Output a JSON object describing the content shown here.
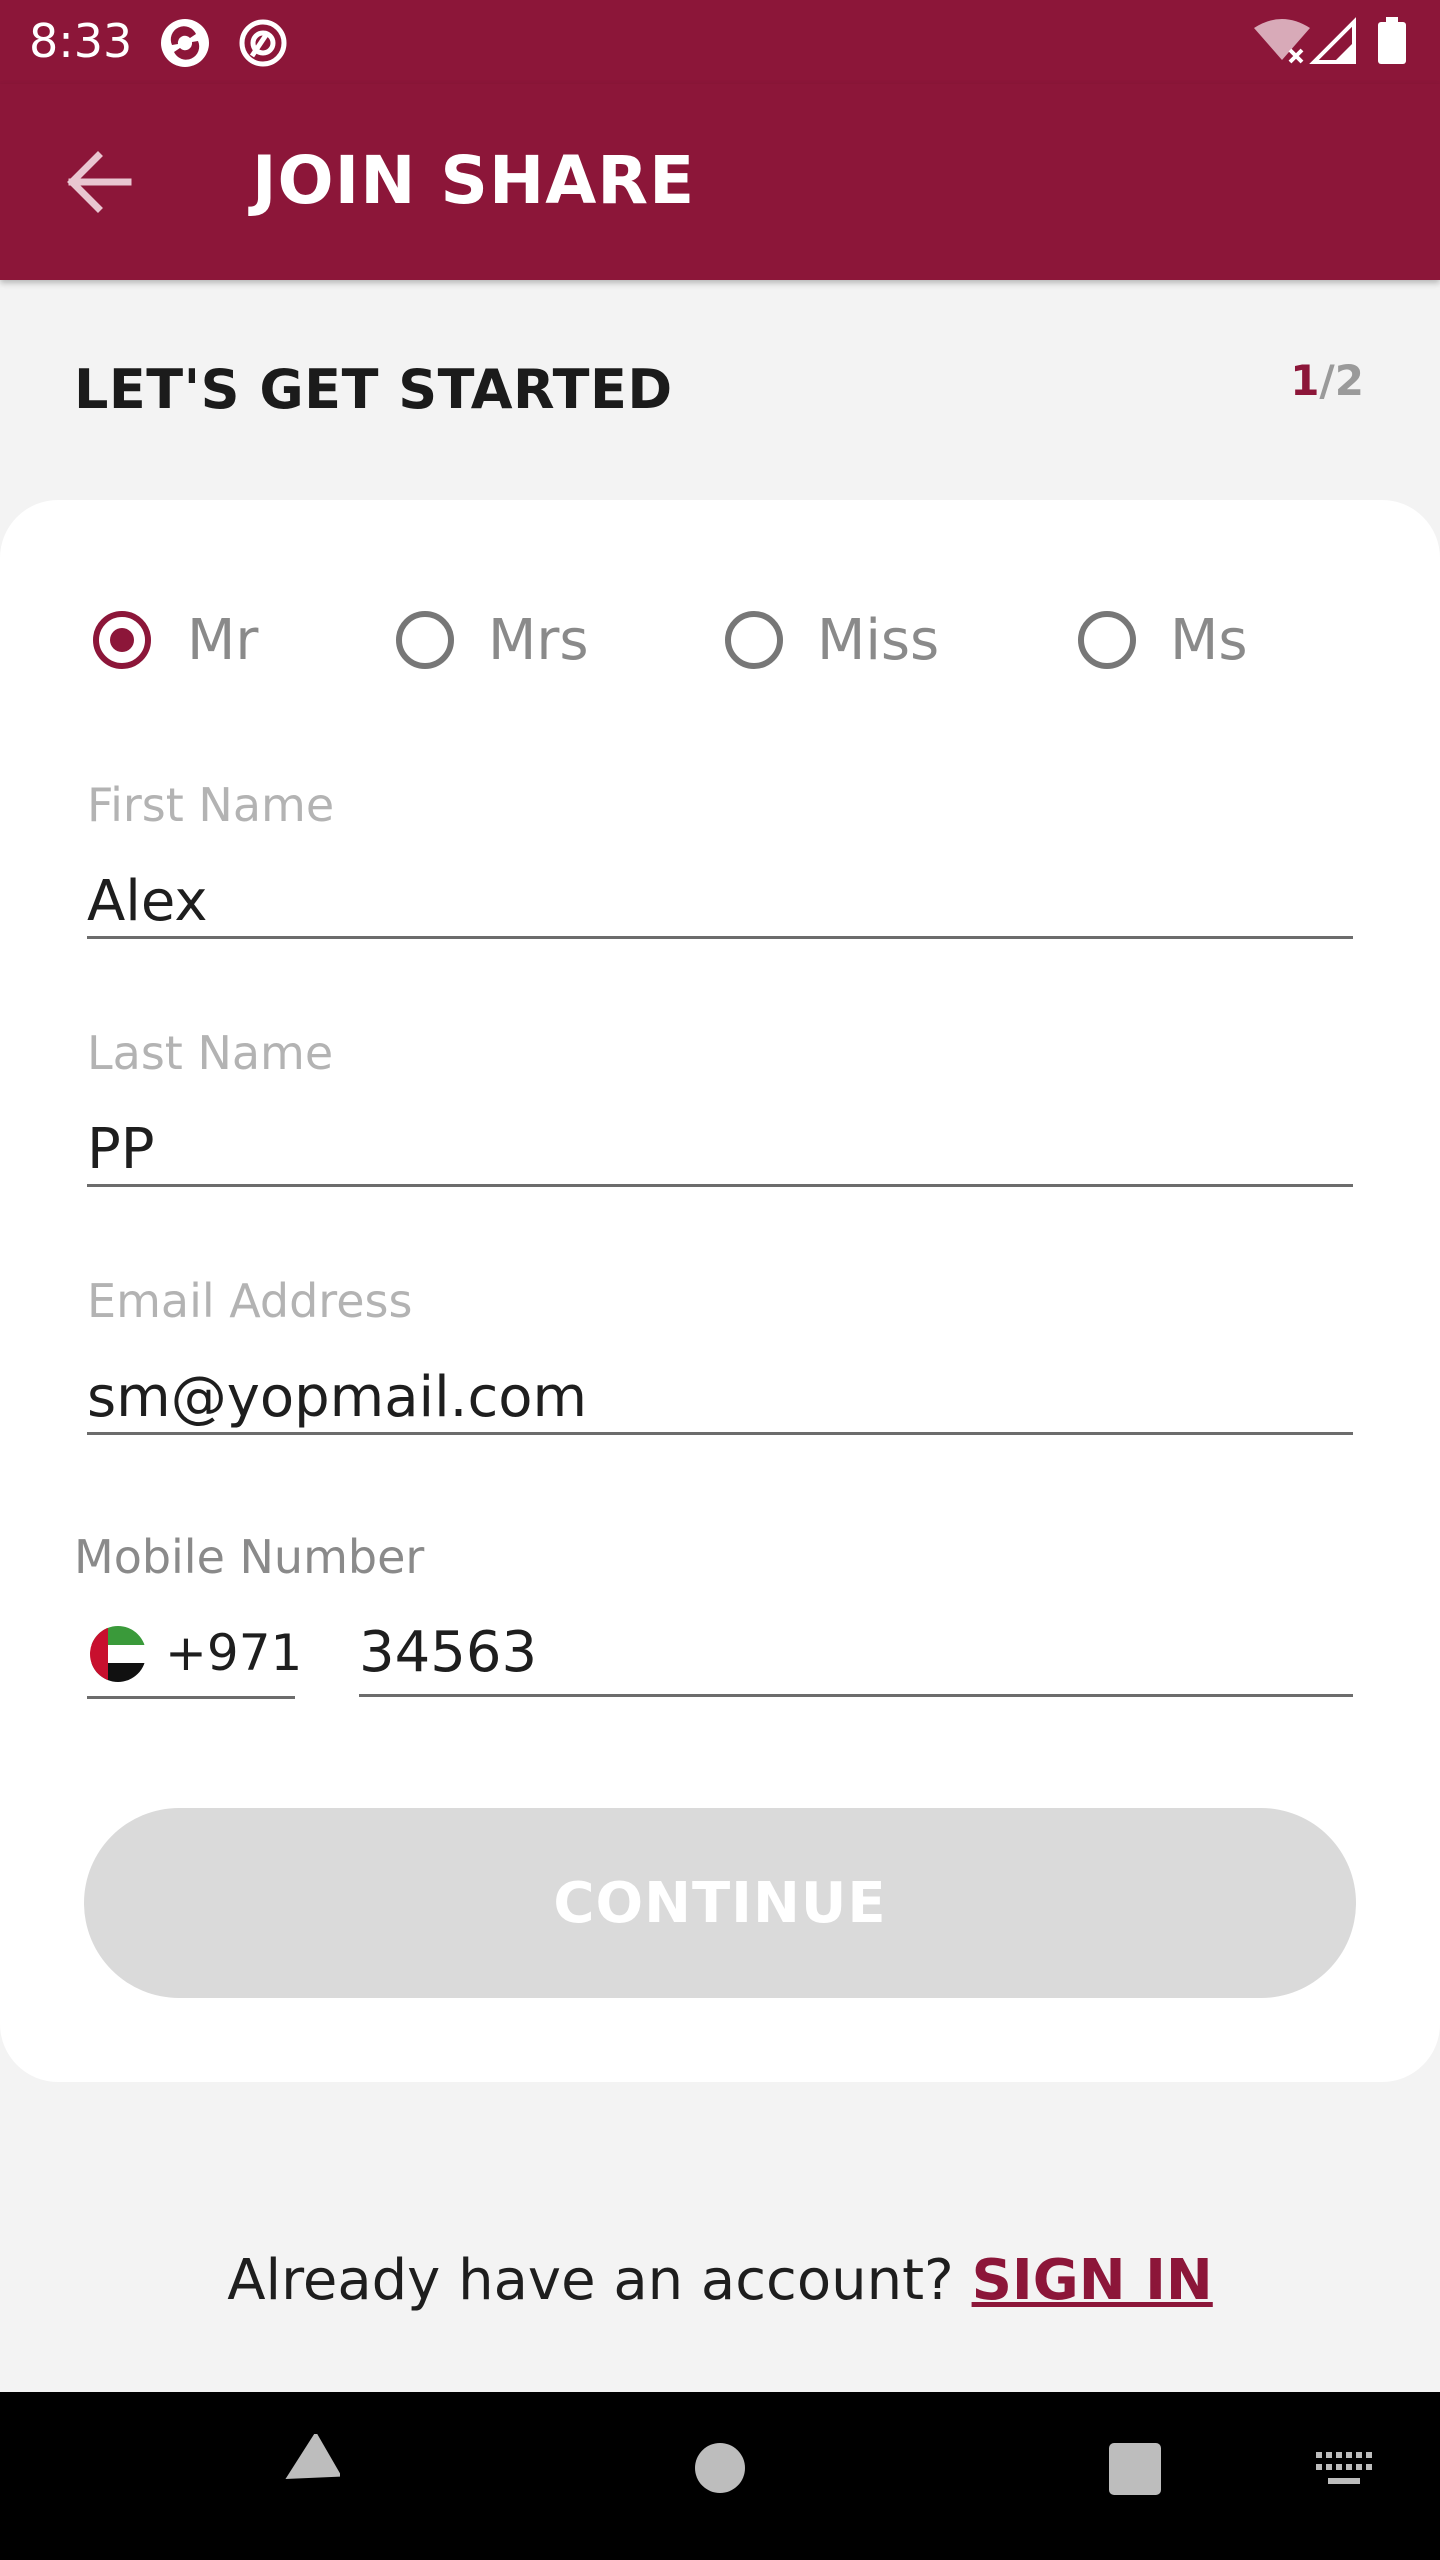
{
  "status_bar": {
    "time": "8:33"
  },
  "app_bar": {
    "title": "JOIN SHARE"
  },
  "header": {
    "title": "LET'S GET STARTED",
    "step_current": "1",
    "step_total": "/2"
  },
  "form": {
    "titles": [
      {
        "label": "Mr",
        "selected": true
      },
      {
        "label": "Mrs",
        "selected": false
      },
      {
        "label": "Miss",
        "selected": false
      },
      {
        "label": "Ms",
        "selected": false
      }
    ],
    "first_name": {
      "label": "First Name",
      "value": "Alex"
    },
    "last_name": {
      "label": "Last Name",
      "value": "PP"
    },
    "email": {
      "label": "Email Address",
      "value": "sm@yopmail.com"
    },
    "mobile": {
      "label": "Mobile Number",
      "dial_code": "+971",
      "value": "34563"
    },
    "continue_label": "CONTINUE"
  },
  "footer": {
    "prompt": "Already have an account?",
    "signin_label": "SIGN IN"
  },
  "colors": {
    "brand": "#8c1639",
    "disabled_button": "#dadada"
  },
  "icons": [
    "back-arrow-icon",
    "uae-flag-icon",
    "wifi-icon",
    "signal-icon",
    "battery-icon"
  ]
}
